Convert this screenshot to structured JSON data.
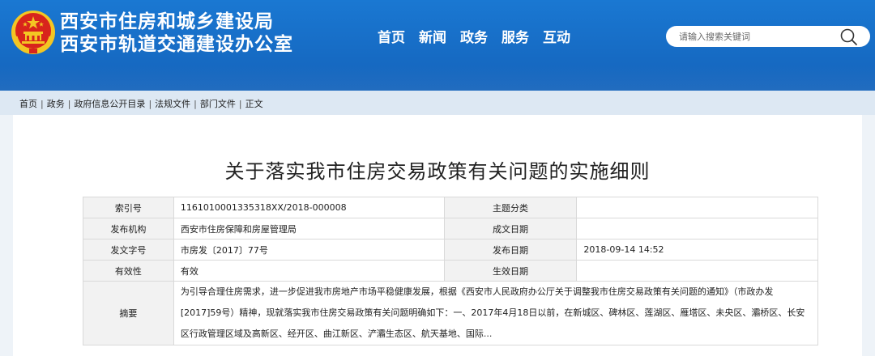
{
  "header": {
    "org_line1": "西安市住房和城乡建设局",
    "org_line2": "西安市轨道交通建设办公室",
    "emblem": "national-emblem"
  },
  "nav": {
    "items": [
      "首页",
      "新闻",
      "政务",
      "服务",
      "互动"
    ]
  },
  "search": {
    "placeholder": "请输入搜索关键词",
    "icon": "search-icon"
  },
  "breadcrumb": {
    "items": [
      "首页",
      "政务",
      "政府信息公开目录",
      "法规文件",
      "部门文件",
      "正文"
    ],
    "separator": "|"
  },
  "document": {
    "title": "关于落实我市住房交易政策有关问题的实施细则",
    "meta": {
      "index_no_label": "索引号",
      "index_no": "1161010001335318XX/2018-000008",
      "topic_label": "主题分类",
      "topic": "",
      "publisher_label": "发布机构",
      "publisher": "西安市住房保障和房屋管理局",
      "created_label": "成文日期",
      "created": "",
      "doc_no_label": "发文字号",
      "doc_no": "市房发〔2017〕77号",
      "publish_date_label": "发布日期",
      "publish_date": "2018-09-14 14:52",
      "validity_label": "有效性",
      "validity": "有效",
      "effective_label": "生效日期",
      "effective": "",
      "abstract_label": "摘要",
      "abstract_line1": "为引导合理住房需求，进一步促进我市房地产市场平稳健康发展，根据《西安市人民政府办公厅关于调整我市住房交易政策有关问题的通知》（市政办发",
      "abstract_line2": "[2017]59号）精神，现就落实我市住房交易政策有关问题明确如下：一、2017年4月18日以前，在新城区、碑林区、莲湖区、雁塔区、未央区、灞桥区、长安",
      "abstract_line3": "区行政管理区域及高新区、经开区、曲江新区、浐灞生态区、航天基地、国际..."
    }
  },
  "colors": {
    "header_blue": "#1a78d2",
    "breadcrumb_bg": "#dde8f3",
    "table_label_bg": "#f2f2f2",
    "emblem_red": "#d8241c",
    "emblem_gold": "#f3c623"
  }
}
